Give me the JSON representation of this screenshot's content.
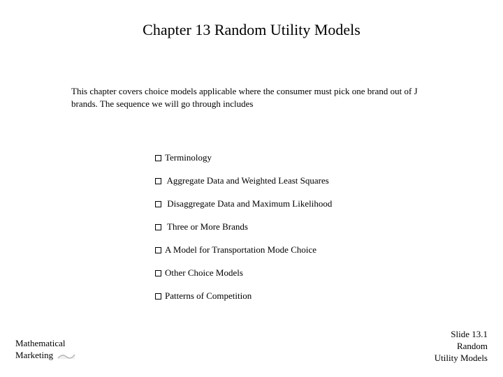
{
  "title": "Chapter 13 Random Utility Models",
  "intro": "This chapter covers choice models applicable where the consumer must pick one brand out of J brands.   The sequence we will go through includes",
  "bullets": [
    "Terminology",
    " Aggregate Data and Weighted Least Squares",
    " Disaggregate Data and Maximum Likelihood",
    " Three or More Brands",
    "A Model for Transportation Mode Choice",
    "Other Choice Models",
    "Patterns of Competition"
  ],
  "footer": {
    "left_line1": "Mathematical",
    "left_line2": "Marketing",
    "right_line1": "Slide 13.1",
    "right_line2": "Random",
    "right_line3": "Utility Models"
  }
}
